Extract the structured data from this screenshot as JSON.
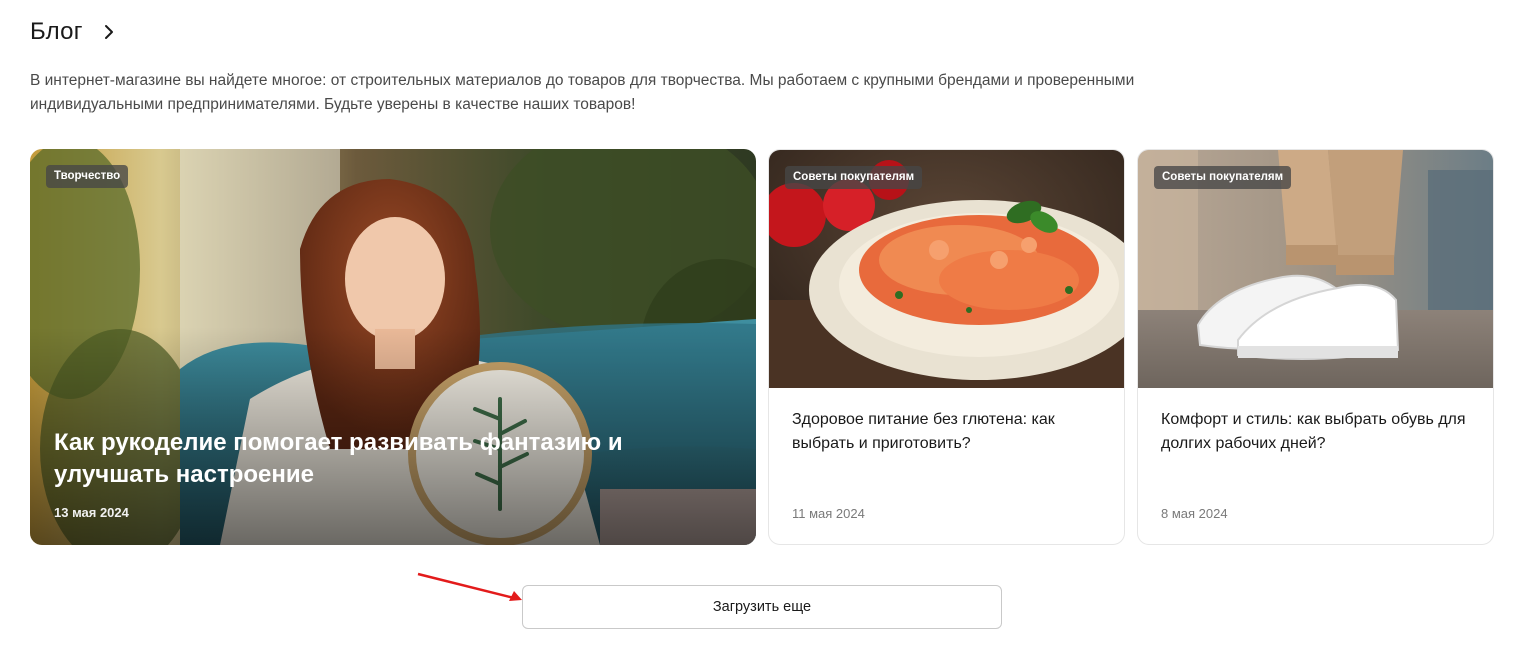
{
  "header": {
    "title": "Блог",
    "chevron_icon": "chevron-right-icon"
  },
  "intro": {
    "text": "В интернет-магазине вы найдете многое: от строительных материалов до товаров для творчества. Мы работаем с крупными брендами и проверенными индивидуальными предпринимателями. Будьте уверены в качестве наших товаров!"
  },
  "cards": [
    {
      "tag": "Творчество",
      "title": "Как рукоделие помогает развивать фантазию и улучшать настроение",
      "date": "13 мая 2024",
      "image": "woman-embroidery-photo"
    },
    {
      "tag": "Советы покупателям",
      "title": "Здоровое питание без глютена: как выбрать и приготовить?",
      "date": "11 мая 2024",
      "image": "pasta-plate-photo"
    },
    {
      "tag": "Советы покупателям",
      "title": "Комфорт и стиль: как выбрать обувь для долгих рабочих дней?",
      "date": "8 мая 2024",
      "image": "white-sneakers-photo"
    }
  ],
  "load_more": {
    "label": "Загрузить еще"
  },
  "colors": {
    "tag_bg": "#464646",
    "annotation_arrow": "#e31b1b",
    "card_border": "#e6e6e6"
  }
}
